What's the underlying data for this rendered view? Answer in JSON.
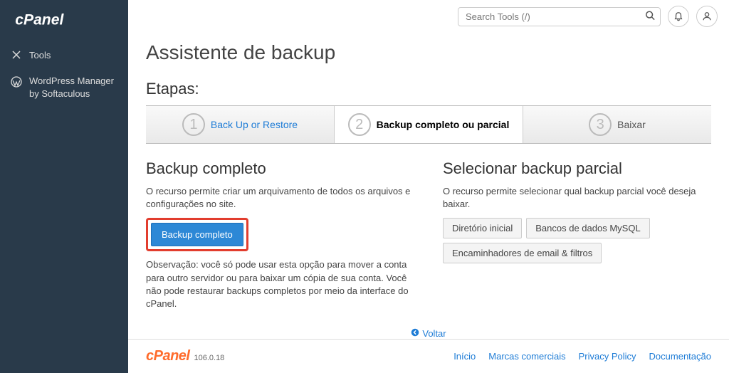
{
  "sidebar": {
    "items": [
      {
        "label": "Tools"
      },
      {
        "label": "WordPress Manager by Softaculous"
      }
    ]
  },
  "search": {
    "placeholder": "Search Tools (/)"
  },
  "page": {
    "title": "Assistente de backup"
  },
  "steps": {
    "label": "Etapas:",
    "items": [
      {
        "num": "1",
        "label": "Back Up or Restore"
      },
      {
        "num": "2",
        "label": "Backup completo ou parcial"
      },
      {
        "num": "3",
        "label": "Baixar"
      }
    ]
  },
  "full_backup": {
    "heading": "Backup completo",
    "description": "O recurso permite criar um arquivamento de todos os arquivos e configurações no site.",
    "button": "Backup completo",
    "note": "Observação: você só pode usar esta opção para mover a conta para outro servidor ou para baixar um cópia de sua conta. Você não pode restaurar backups completos por meio da interface do cPanel."
  },
  "partial_backup": {
    "heading": "Selecionar backup parcial",
    "description": "O recurso permite selecionar qual backup parcial você deseja baixar.",
    "options": [
      "Diretório inicial",
      "Bancos de dados MySQL",
      "Encaminhadores de email & filtros"
    ]
  },
  "back_link": "Voltar",
  "footer": {
    "brand": "cPanel",
    "version": "106.0.18",
    "links": [
      "Início",
      "Marcas comerciais",
      "Privacy Policy",
      "Documentação"
    ]
  }
}
